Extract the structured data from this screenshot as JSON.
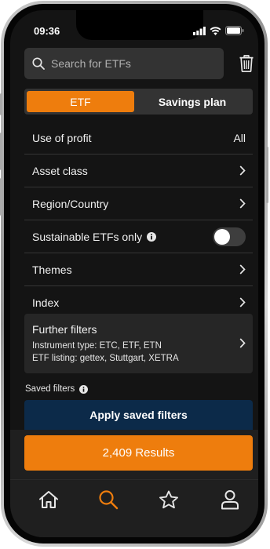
{
  "status": {
    "time": "09:36"
  },
  "search": {
    "placeholder": "Search for ETFs"
  },
  "segment": {
    "etf_label": "ETF",
    "savings_label": "Savings plan",
    "active": "ETF"
  },
  "filters": [
    {
      "label": "Use of profit",
      "value": "All"
    },
    {
      "label": "Asset class"
    },
    {
      "label": "Region/Country"
    },
    {
      "label": "Sustainable ETFs only",
      "toggle": false
    },
    {
      "label": "Themes"
    },
    {
      "label": "Index"
    }
  ],
  "further_filters": {
    "title": "Further filters",
    "line1": "Instrument type: ETC, ETF, ETN",
    "line2": "ETF listing: gettex, Stuttgart, XETRA"
  },
  "saved_filters": {
    "label": "Saved filters",
    "apply_label": "Apply saved filters"
  },
  "results": {
    "label": "2,409 Results"
  },
  "tabbar": {
    "items": [
      "home-icon",
      "search-icon",
      "star-icon",
      "profile-icon"
    ],
    "active": "search-icon"
  },
  "colors": {
    "accent": "#ee7d0d",
    "apply_bg": "#0c2a49",
    "background": "#141414"
  }
}
